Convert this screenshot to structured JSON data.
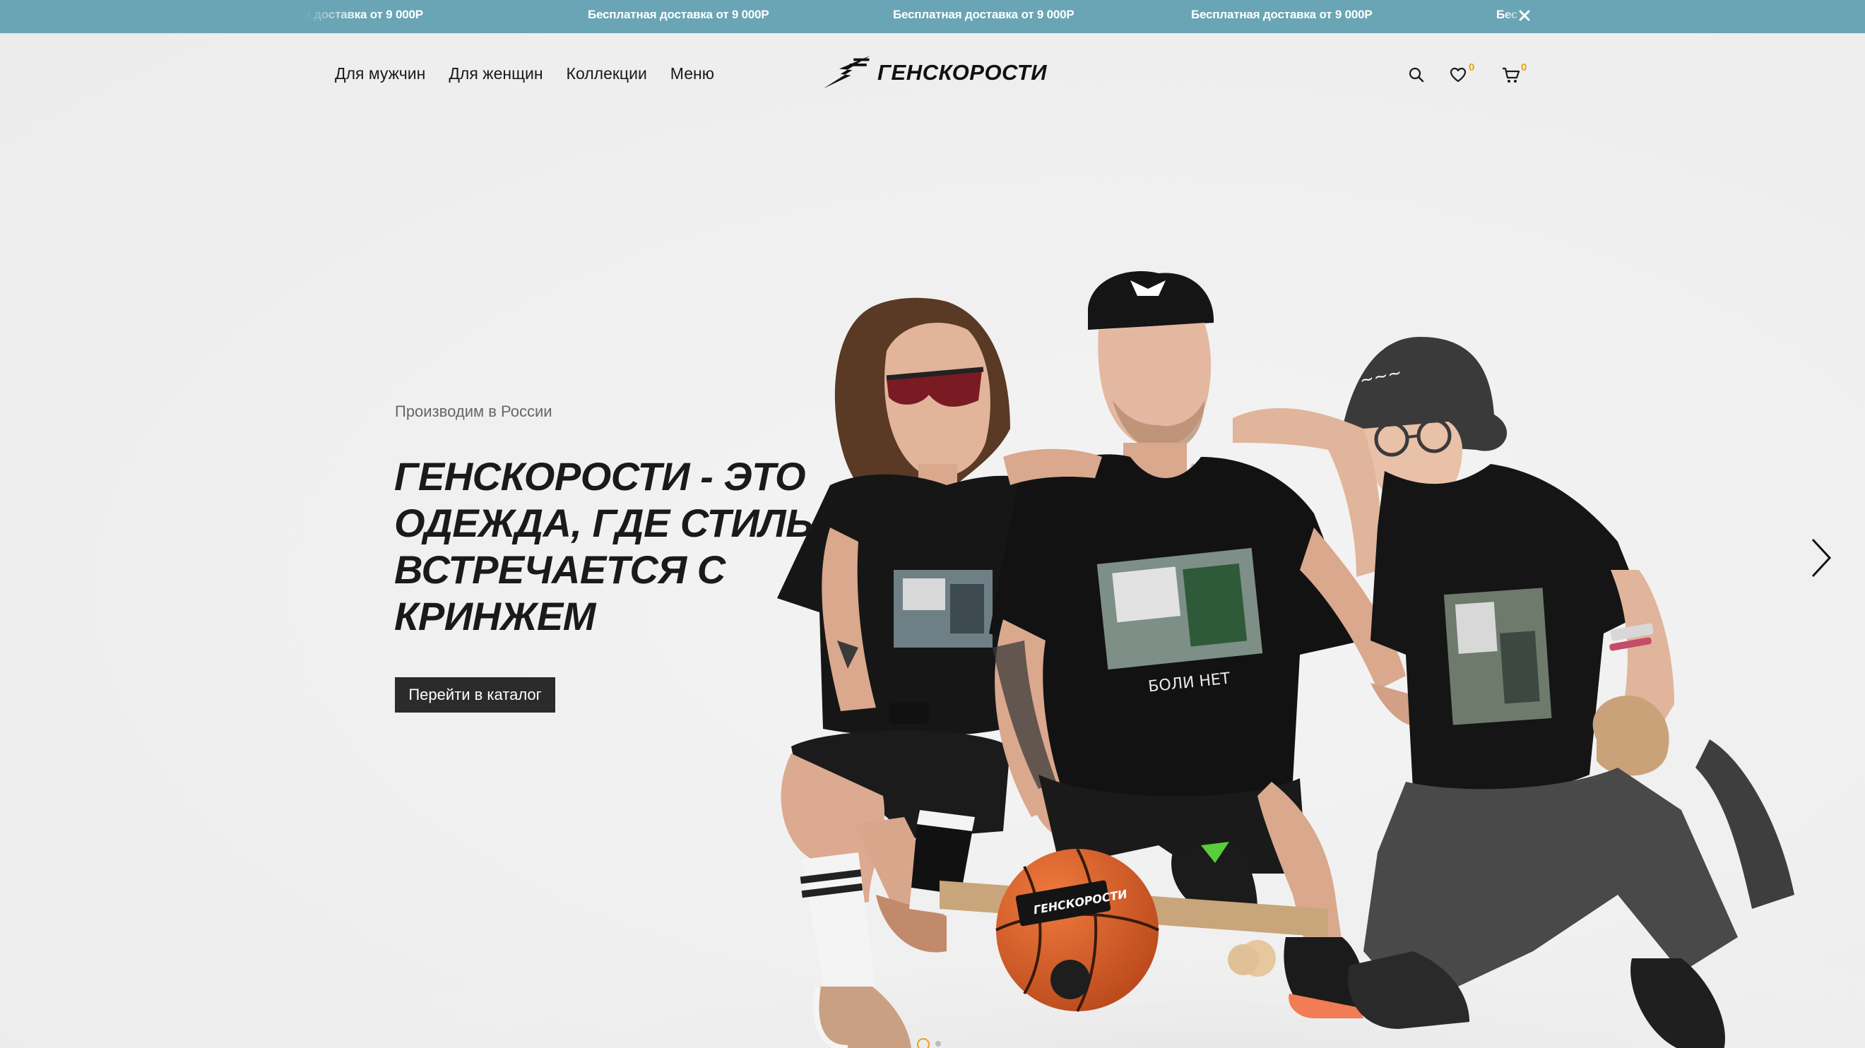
{
  "promo": {
    "items": [
      "я доставка от 9 000Р",
      "Бесплатная доставка от 9 000Р",
      "Бесплатная доставка от 9 000Р",
      "Бесплатная доставка от 9 000Р",
      "Бес"
    ],
    "background": "#6aa5b5"
  },
  "header": {
    "nav": [
      "Для мужчин",
      "Для женщин",
      "Коллекции",
      "Меню"
    ],
    "logo_text": "ГЕНСКОРОСТИ",
    "wishlist_count": "0",
    "cart_count": "0"
  },
  "hero": {
    "eyebrow": "Производим в России",
    "headline": "ГЕНСКОРОСТИ - ЭТО ОДЕЖДА, ГДЕ СТИЛЬ ВСТРЕЧАЕТСЯ С КРИНЖЕМ",
    "cta_label": "Перейти в каталог",
    "tshirt_print_text": "БОЛИ НЕТ",
    "ball_print_text": "ГЕНСКОРОСТИ",
    "slides_count": 2,
    "active_slide": 1
  },
  "colors": {
    "accent": "#e8a317",
    "button": "#2b2b2b",
    "text": "#1a1a1a"
  },
  "icons": [
    "close-icon",
    "search-icon",
    "heart-icon",
    "cart-icon",
    "chevron-right-icon",
    "lightning-logo-icon"
  ]
}
